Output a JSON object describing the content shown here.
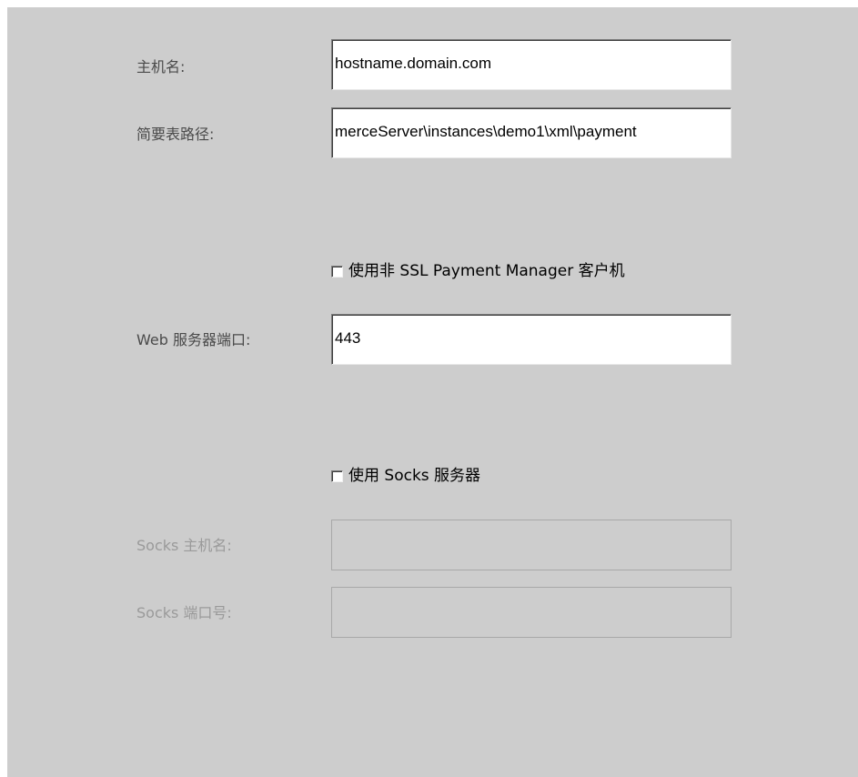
{
  "form": {
    "hostname": {
      "label": "主机名:",
      "value": "hostname.domain.com"
    },
    "profile_path": {
      "label": "简要表路径:",
      "value": "merceServer\\instances\\demo1\\xml\\payment"
    },
    "non_ssl_checkbox": {
      "label": "使用非 SSL Payment Manager 客户机",
      "checked": false
    },
    "web_server_port": {
      "label": "Web 服务器端口:",
      "value": "443"
    },
    "socks_checkbox": {
      "label": "使用 Socks 服务器",
      "checked": false
    },
    "socks_hostname": {
      "label": "Socks 主机名:",
      "value": "",
      "disabled": true
    },
    "socks_port": {
      "label": "Socks 端口号:",
      "value": "",
      "disabled": true
    }
  }
}
